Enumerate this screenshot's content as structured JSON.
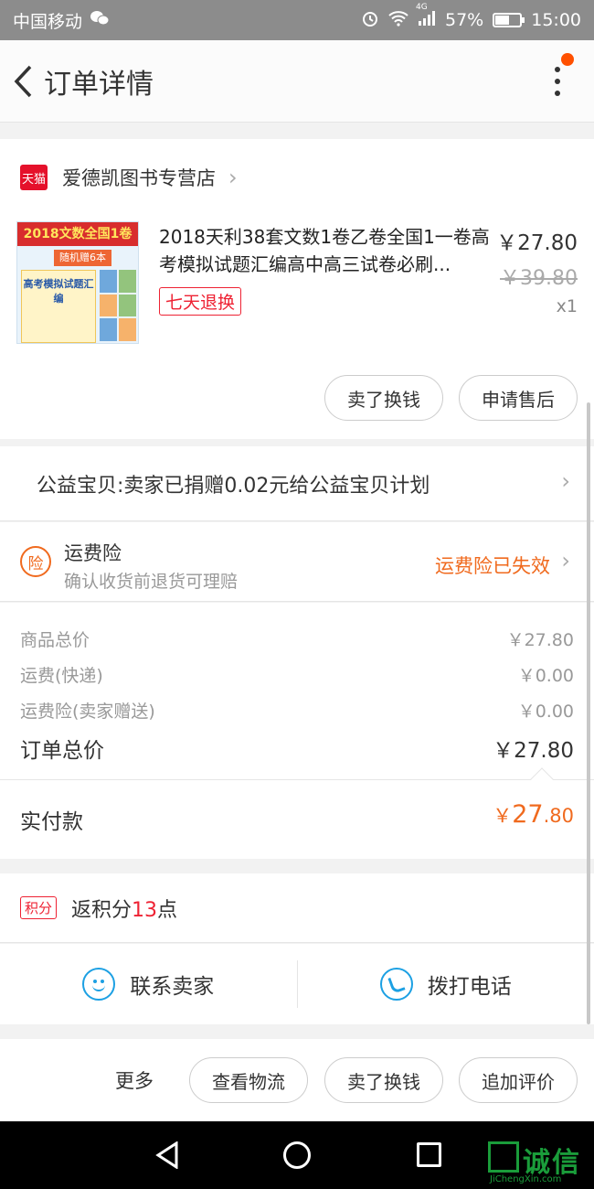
{
  "status_bar": {
    "carrier": "中国移动",
    "network": "4G",
    "battery_percent": "57%",
    "battery_level": 0.57,
    "time": "15:00"
  },
  "nav": {
    "title": "订单详情"
  },
  "shop": {
    "badge": "天猫",
    "name": "爱德凯图书专营店"
  },
  "product": {
    "thumb_banner": "2018文数全国1卷",
    "thumb_tag": "随机赠6本",
    "thumb_title": "高考模拟试题汇编",
    "title": "2018天利38套文数1卷乙卷全国1一卷高考模拟试题汇编高中高三试卷必刷...",
    "tag": "七天退换",
    "price": "￥27.80",
    "original_price": "￥39.80",
    "quantity": "x1",
    "actions": [
      "卖了换钱",
      "申请售后"
    ]
  },
  "charity": {
    "text": "公益宝贝:卖家已捐赠0.02元给公益宝贝计划"
  },
  "insurance": {
    "icon_char": "险",
    "title": "运费险",
    "subtitle": "确认收货前退货可理赔",
    "status": "运费险已失效"
  },
  "totals": {
    "rows": [
      {
        "label": "商品总价",
        "value": "￥27.80"
      },
      {
        "label": "运费(快递)",
        "value": "￥0.00"
      },
      {
        "label": "运费险(卖家赠送)",
        "value": "￥0.00"
      }
    ],
    "order_total_label": "订单总价",
    "order_total_value": "￥27.80"
  },
  "paid": {
    "label": "实付款",
    "currency": "￥",
    "integer": "27",
    "decimal": ".80"
  },
  "points": {
    "badge": "积分",
    "prefix": "返积分",
    "amount": "13",
    "suffix": "点"
  },
  "contact": {
    "seller": "联系卖家",
    "call": "拨打电话"
  },
  "bottom_bar": {
    "more": "更多",
    "buttons": [
      "查看物流",
      "卖了换钱",
      "追加评价"
    ]
  },
  "watermark": {
    "text": "诚信",
    "sub": "JiChengXin.com"
  },
  "colors": {
    "accent_orange": "#f06a1e",
    "tmall_red": "#e5112b",
    "contact_blue": "#1ca0e3"
  }
}
